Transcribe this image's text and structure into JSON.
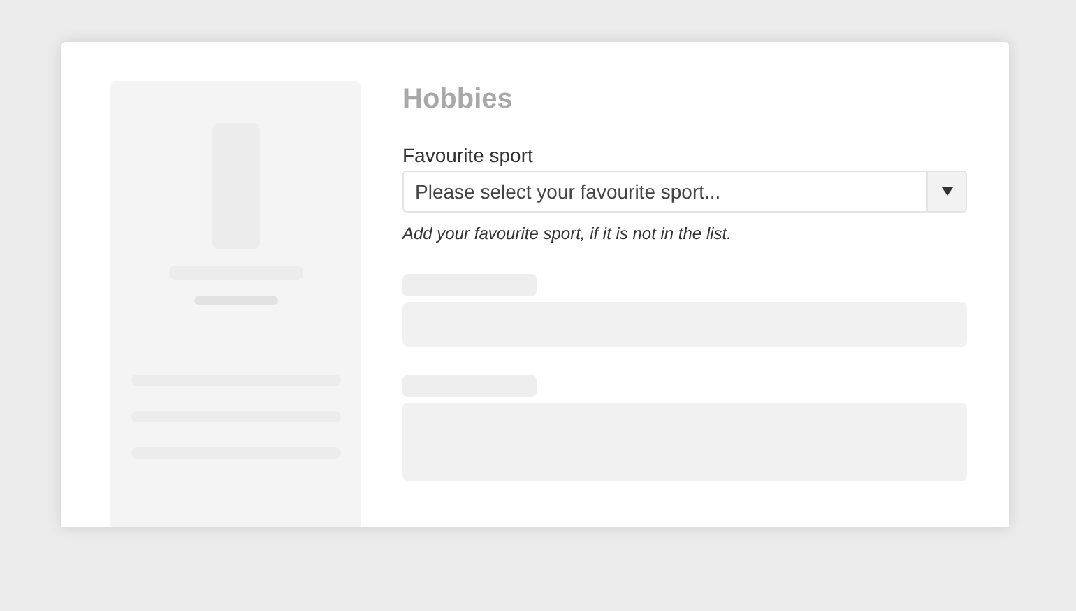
{
  "section": {
    "title": "Hobbies"
  },
  "sport_field": {
    "label": "Favourite sport",
    "placeholder": "Please select your favourite sport...",
    "hint": "Add your favourite sport, if it is not in the list."
  }
}
